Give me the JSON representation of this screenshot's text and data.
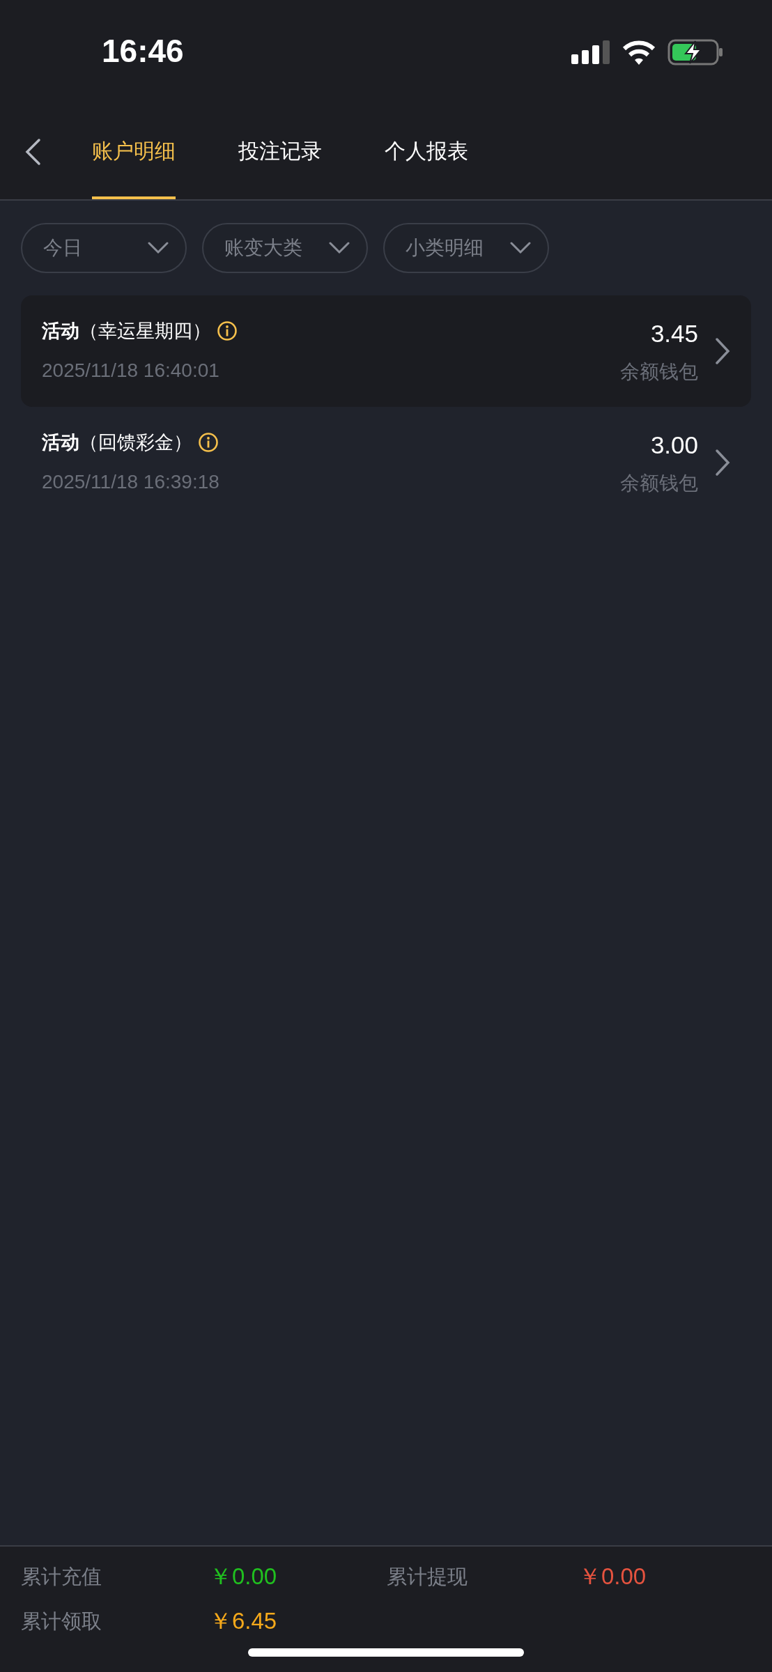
{
  "status_bar": {
    "time": "16:46",
    "charging": true
  },
  "tabs": [
    {
      "label": "账户明细",
      "selected": true
    },
    {
      "label": "投注记录",
      "selected": false
    },
    {
      "label": "个人报表",
      "selected": false
    }
  ],
  "filters": [
    {
      "label": "今日"
    },
    {
      "label": "账变大类"
    },
    {
      "label": "小类明细"
    }
  ],
  "records": [
    {
      "title": "活动",
      "subtitle": "（幸运星期四）",
      "time": "2025/11/18 16:40:01",
      "amount": "3.45",
      "wallet": "余额钱包",
      "selected": true
    },
    {
      "title": "活动",
      "subtitle": "（回馈彩金）",
      "time": "2025/11/18 16:39:18",
      "amount": "3.00",
      "wallet": "余额钱包",
      "selected": false
    }
  ],
  "summary": [
    {
      "label": "累计充值",
      "value": "￥0.00",
      "color": "#20c01f"
    },
    {
      "label": "累计提现",
      "value": "￥0.00",
      "color": "#e5533f"
    },
    {
      "label": "累计领取",
      "value": "￥6.45",
      "color": "#f5a91b"
    }
  ]
}
